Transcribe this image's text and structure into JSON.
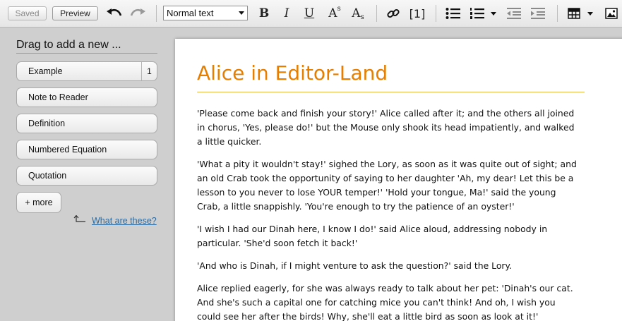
{
  "toolbar": {
    "saved_label": "Saved",
    "preview_label": "Preview",
    "text_style": "Normal text",
    "link_index_label": "[1]",
    "icons": [
      "undo-icon",
      "redo-icon",
      "bold-icon",
      "italic-icon",
      "underline-icon",
      "superscript-icon",
      "subscript-icon",
      "link-icon",
      "footnote-icon",
      "bulleted-list-icon",
      "numbered-list-icon",
      "outdent-icon",
      "indent-icon",
      "table-icon",
      "image-icon"
    ],
    "bold_glyph": "B",
    "italic_glyph": "I",
    "underline_glyph": "U",
    "super_glyph": "A",
    "super_mark": "s",
    "sub_glyph": "A",
    "sub_mark": "s"
  },
  "sidebar": {
    "title": "Drag to add a new ...",
    "items": [
      {
        "label": "Example",
        "count": "1"
      },
      {
        "label": "Note to Reader"
      },
      {
        "label": "Definition"
      },
      {
        "label": "Numbered Equation"
      },
      {
        "label": "Quotation"
      }
    ],
    "more_label": "+ more",
    "help_label": "What are these?"
  },
  "document": {
    "title": "Alice in Editor-Land",
    "paragraphs": [
      "'Please come back and finish your story!' Alice called after it; and the others all joined in chorus, 'Yes, please do!' but the Mouse only shook its head impatiently, and walked a little quicker.",
      "'What a pity it wouldn't stay!' sighed the Lory, as soon as it was quite out of sight; and an old Crab took the opportunity of saying to her daughter 'Ah, my dear! Let this be a lesson to you never to lose YOUR temper!' 'Hold your tongue, Ma!' said the young Crab, a little snappishly. 'You're enough to try the patience of an oyster!'",
      "'I wish I had our Dinah here, I know I do!' said Alice aloud, addressing nobody in particular. 'She'd soon fetch it back!'",
      "'And who is Dinah, if I might venture to ask the question?' said the Lory.",
      "Alice replied eagerly, for she was always ready to talk about her pet: 'Dinah's our cat. And she's such a capital one for catching mice you can't think! And oh, I wish you could see her after the birds! Why, she'll eat a little bird as soon as look at it!'"
    ]
  },
  "colors": {
    "title": "#e67e00",
    "link": "#2a6aa0"
  }
}
